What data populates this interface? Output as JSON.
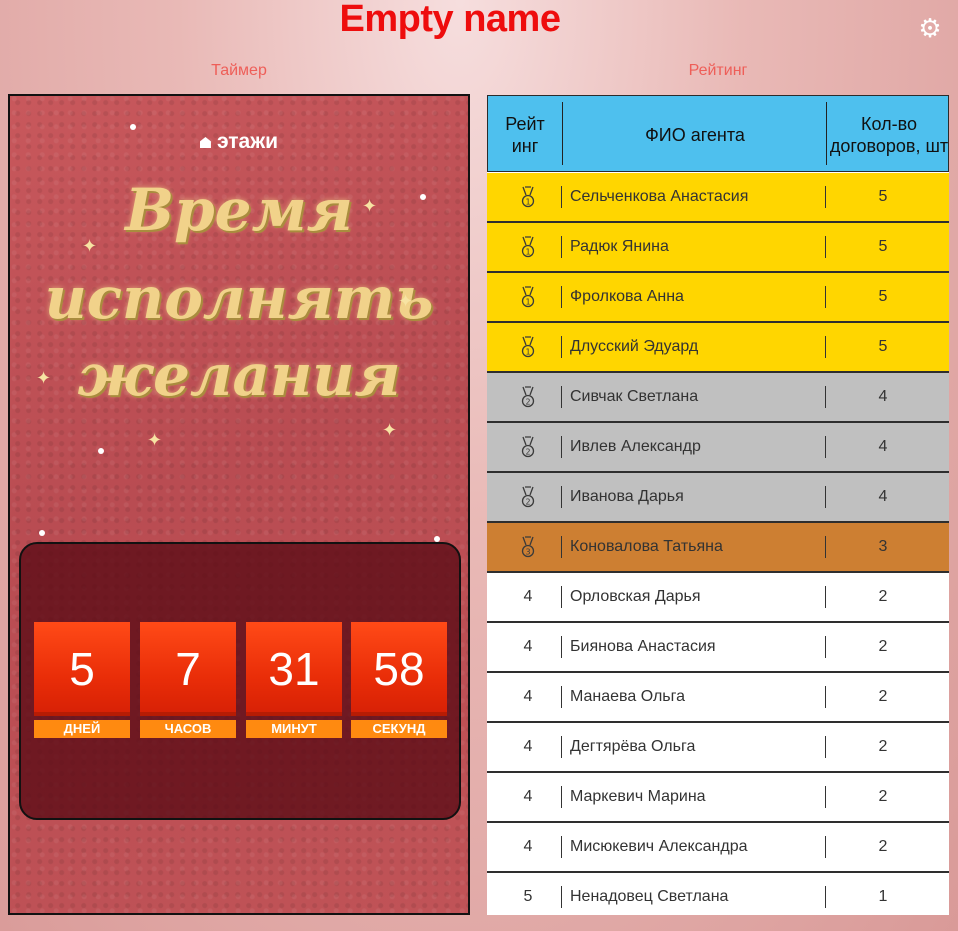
{
  "app": {
    "title": "Empty name"
  },
  "icons": {
    "settings": "gear-icon"
  },
  "sections": {
    "timer": "Таймер",
    "rating": "Рейтинг"
  },
  "timer": {
    "brand": "этажи",
    "headline": [
      "Время",
      "исполнять",
      "желания"
    ],
    "units": [
      {
        "value": "5",
        "label": "ДНЕЙ"
      },
      {
        "value": "7",
        "label": "ЧАСОВ"
      },
      {
        "value": "31",
        "label": "МИНУТ"
      },
      {
        "value": "58",
        "label": "СЕКУНД"
      }
    ]
  },
  "table": {
    "headers": {
      "rank": "Рейтинг",
      "name": "ФИО агента",
      "count": "Кол-во договоров, шт"
    },
    "colors": {
      "header": "#4ec0ee",
      "gold": "#ffd600",
      "silver": "#c0c0c0",
      "bronze": "#cd7f32",
      "normal": "#ffffff"
    },
    "rows": [
      {
        "rank": "",
        "medal": "gold-medal-icon",
        "name": "Сельченкова Анастасия",
        "count": "5",
        "tier": "gold"
      },
      {
        "rank": "",
        "medal": "gold-medal-icon",
        "name": "Радюк Янина",
        "count": "5",
        "tier": "gold"
      },
      {
        "rank": "",
        "medal": "gold-medal-icon",
        "name": "Фролкова Анна",
        "count": "5",
        "tier": "gold"
      },
      {
        "rank": "",
        "medal": "gold-medal-icon",
        "name": "Длусский Эдуард",
        "count": "5",
        "tier": "gold"
      },
      {
        "rank": "",
        "medal": "silver-medal-icon",
        "name": "Сивчак Светлана",
        "count": "4",
        "tier": "silver"
      },
      {
        "rank": "",
        "medal": "silver-medal-icon",
        "name": "Ивлев Александр",
        "count": "4",
        "tier": "silver"
      },
      {
        "rank": "",
        "medal": "silver-medal-icon",
        "name": "Иванова Дарья",
        "count": "4",
        "tier": "silver"
      },
      {
        "rank": "",
        "medal": "bronze-medal-icon",
        "name": "Коновалова Татьяна",
        "count": "3",
        "tier": "bronze"
      },
      {
        "rank": "4",
        "medal": "",
        "name": "Орловская Дарья",
        "count": "2",
        "tier": "normal"
      },
      {
        "rank": "4",
        "medal": "",
        "name": "Биянова Анастасия",
        "count": "2",
        "tier": "normal"
      },
      {
        "rank": "4",
        "medal": "",
        "name": "Манаева Ольга",
        "count": "2",
        "tier": "normal"
      },
      {
        "rank": "4",
        "medal": "",
        "name": "Дегтярёва Ольга",
        "count": "2",
        "tier": "normal"
      },
      {
        "rank": "4",
        "medal": "",
        "name": "Маркевич Марина",
        "count": "2",
        "tier": "normal"
      },
      {
        "rank": "4",
        "medal": "",
        "name": "Мисюкевич Александра",
        "count": "2",
        "tier": "normal"
      },
      {
        "rank": "5",
        "medal": "",
        "name": "Ненадовец Светлана",
        "count": "1",
        "tier": "normal"
      }
    ]
  }
}
